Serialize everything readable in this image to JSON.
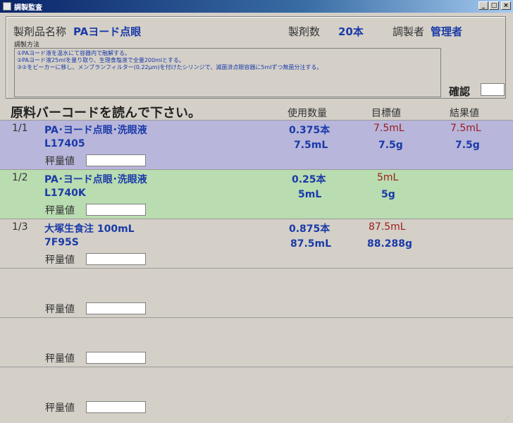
{
  "window": {
    "title": "調製監査"
  },
  "header": {
    "product_label": "製剤品名称",
    "product_name": "PAヨード点眼",
    "count_label": "製剤数",
    "count_value": "20本",
    "preparer_label": "調製者",
    "preparer_value": "管理者",
    "method_label": "調製方法",
    "method_lines": [
      "①PAヨード液を温水にて容器内で融解する。",
      "②PAヨード液25mlを量り取り、生理食塩液で全量200mlとする。",
      "③②をビーカーに移し、メンブランフィルター(0.22μm)を付けたシリンジで、滅菌済点眼容器に5mlずつ無菌分注する。"
    ],
    "confirm_label": "確認"
  },
  "instruction": "原料バーコードを読んで下さい。",
  "columns": {
    "usage": "使用数量",
    "target": "目標値",
    "result": "結果値"
  },
  "weight_label": "秤量値",
  "rows": [
    {
      "index": "1/1",
      "name": "PA･ヨード点眼･洗眼液",
      "code": "L17405",
      "usage1": "0.375本",
      "usage2": "7.5mL",
      "target1": "7.5mL",
      "target2": "7.5g",
      "result1": "7.5mL",
      "result2": "7.5g"
    },
    {
      "index": "1/2",
      "name": "PA･ヨード点眼･洗眼液",
      "code": "L1740K",
      "usage1": "0.25本",
      "usage2": "5mL",
      "target1": "5mL",
      "target2": "5g",
      "result1": "",
      "result2": ""
    },
    {
      "index": "1/3",
      "name": "大塚生食注 100mL",
      "code": "7F95S",
      "usage1": "0.875本",
      "usage2": "87.5mL",
      "target1": "87.5mL",
      "target2": "88.288g",
      "result1": "",
      "result2": ""
    },
    {
      "index": "",
      "name": "",
      "code": "",
      "usage1": "",
      "usage2": "",
      "target1": "",
      "target2": "",
      "result1": "",
      "result2": ""
    },
    {
      "index": "",
      "name": "",
      "code": "",
      "usage1": "",
      "usage2": "",
      "target1": "",
      "target2": "",
      "result1": "",
      "result2": ""
    },
    {
      "index": "",
      "name": "",
      "code": "",
      "usage1": "",
      "usage2": "",
      "target1": "",
      "target2": "",
      "result1": "",
      "result2": ""
    }
  ],
  "colors": {
    "row_done": "#b8b6db",
    "row_pending": "#b9dcb0",
    "row_default": "#d4d0c8",
    "accent_blue": "#1a3aa8",
    "accent_red": "#9b1b1b"
  },
  "icons": {
    "minimize": "minimize-icon",
    "maximize": "maximize-icon",
    "close": "close-icon"
  }
}
